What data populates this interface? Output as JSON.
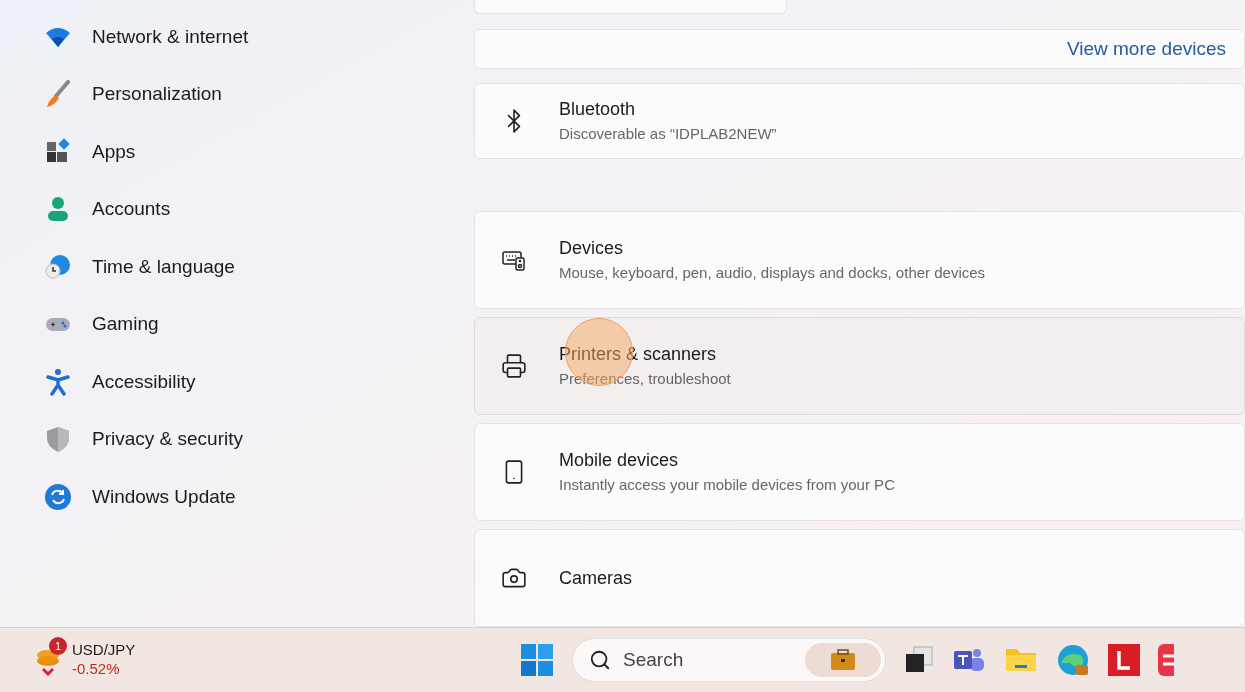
{
  "sidebar": {
    "items": [
      {
        "label": "Network & internet"
      },
      {
        "label": "Personalization"
      },
      {
        "label": "Apps"
      },
      {
        "label": "Accounts"
      },
      {
        "label": "Time & language"
      },
      {
        "label": "Gaming"
      },
      {
        "label": "Accessibility"
      },
      {
        "label": "Privacy & security"
      },
      {
        "label": "Windows Update"
      }
    ]
  },
  "content": {
    "view_more": "View more devices",
    "bluetooth": {
      "title": "Bluetooth",
      "subtitle": "Discoverable as “IDPLAB2NEW”"
    },
    "cards": [
      {
        "title": "Devices",
        "subtitle": "Mouse, keyboard, pen, audio, displays and docks, other devices",
        "hovered": false
      },
      {
        "title": "Printers & scanners",
        "subtitle": "Preferences, troubleshoot",
        "hovered": true
      },
      {
        "title": "Mobile devices",
        "subtitle": "Instantly access your mobile devices from your PC",
        "hovered": false
      },
      {
        "title": "Cameras",
        "hovered": false
      }
    ]
  },
  "taskbar": {
    "widget": {
      "badge": "1",
      "symbol": "USD/JPY",
      "change": "-0.52%"
    },
    "search": {
      "placeholder": "Search"
    }
  }
}
